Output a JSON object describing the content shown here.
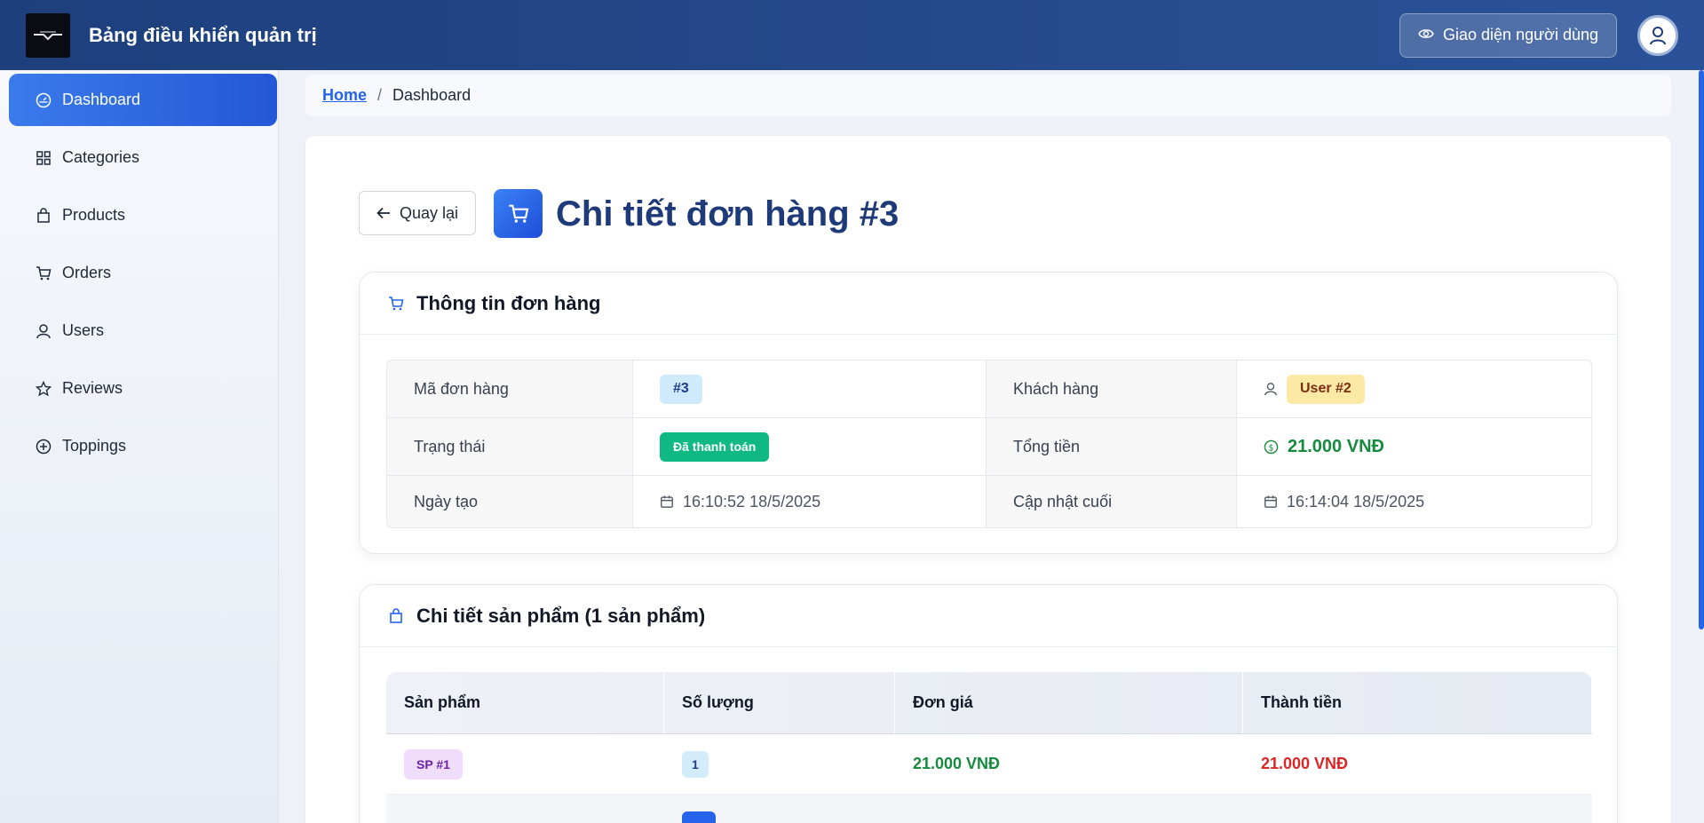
{
  "header": {
    "app_title": "Bảng điều khiển quản trị",
    "user_view_label": "Giao diện người dùng"
  },
  "sidebar": {
    "items": [
      {
        "label": "Dashboard",
        "icon": "dashboard-icon",
        "active": true
      },
      {
        "label": "Categories",
        "icon": "grid-icon"
      },
      {
        "label": "Products",
        "icon": "bag-icon"
      },
      {
        "label": "Orders",
        "icon": "cart-icon"
      },
      {
        "label": "Users",
        "icon": "user-icon"
      },
      {
        "label": "Reviews",
        "icon": "star-icon"
      },
      {
        "label": "Toppings",
        "icon": "plus-circle-icon"
      }
    ]
  },
  "breadcrumb": {
    "home": "Home",
    "separator": "/",
    "current": "Dashboard"
  },
  "page": {
    "back_label": "Quay lại",
    "title": "Chi tiết đơn hàng #3"
  },
  "order_info": {
    "title": "Thông tin đơn hàng",
    "order_id_label": "Mã đơn hàng",
    "order_id": "#3",
    "customer_label": "Khách hàng",
    "customer": "User #2",
    "status_label": "Trạng thái",
    "status": "Đã thanh toán",
    "total_label": "Tổng tiền",
    "total": "21.000 VNĐ",
    "created_label": "Ngày tạo",
    "created": "16:10:52 18/5/2025",
    "updated_label": "Cập nhật cuối",
    "updated": "16:14:04 18/5/2025"
  },
  "products": {
    "title": "Chi tiết sản phẩm (1 sản phẩm)",
    "columns": [
      "Sản phẩm",
      "Số lượng",
      "Đơn giá",
      "Thành tiền"
    ],
    "rows": [
      {
        "product": "SP #1",
        "quantity": "1",
        "unit_price": "21.000 VNĐ",
        "line_total": "21.000 VNĐ"
      }
    ]
  },
  "colors": {
    "header_bg": "#1d3f7c",
    "active_nav": "#2457d6",
    "total_green": "#168a3e",
    "line_total_red": "#dc2626"
  }
}
